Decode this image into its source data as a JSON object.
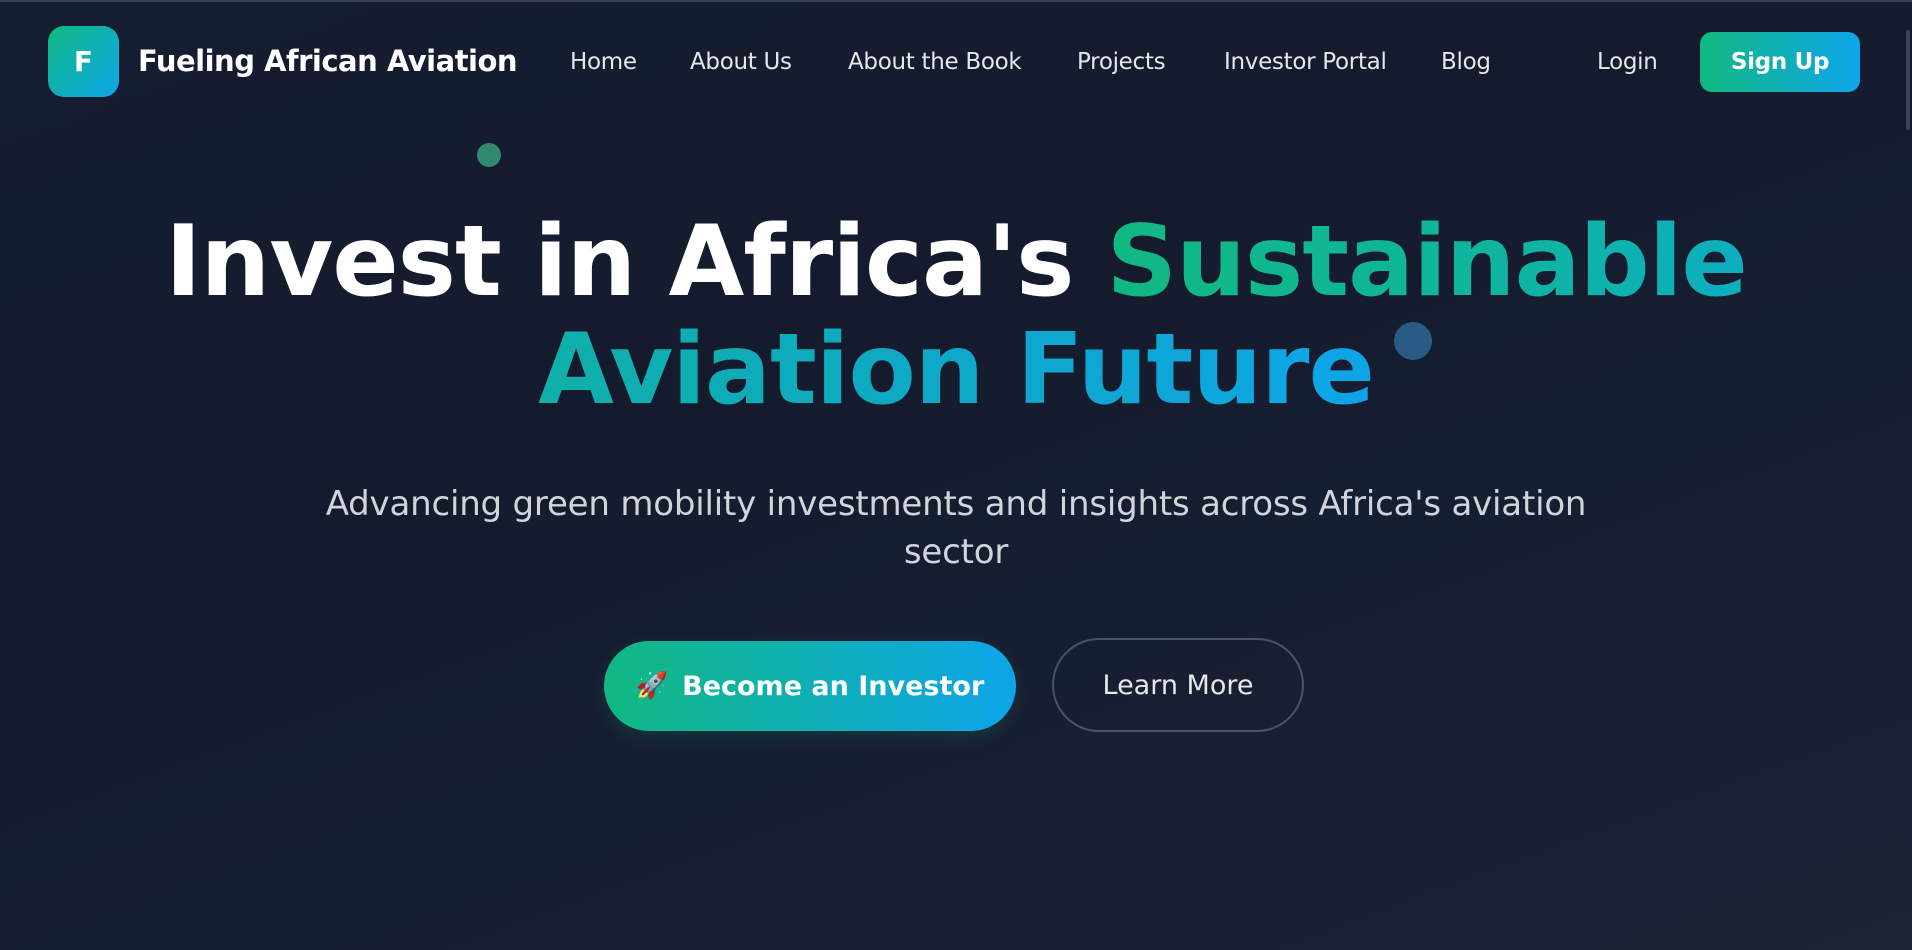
{
  "brand": {
    "logo_letter": "F",
    "name": "Fueling African Aviation"
  },
  "nav": {
    "links": [
      {
        "label": "Home"
      },
      {
        "label": "About Us"
      },
      {
        "label": "About the Book"
      },
      {
        "label": "Projects"
      },
      {
        "label": "Investor Portal"
      },
      {
        "label": "Blog"
      }
    ],
    "login_label": "Login",
    "signup_label": "Sign Up"
  },
  "hero": {
    "title_part1": "Invest in Africa's ",
    "title_part2": "Sustainable",
    "title_part3": "Aviation Future",
    "subtitle": "Advancing green mobility investments and insights across Africa's aviation sector",
    "primary_cta_icon": "🚀",
    "primary_cta_label": "Become an Investor",
    "secondary_cta_label": "Learn More"
  },
  "colors": {
    "accent_green": "#10b981",
    "accent_blue": "#0ea5e9",
    "background": "#151d30"
  },
  "icons": {
    "logo": "logo-mark-icon",
    "primary_cta": "rocket-icon"
  }
}
